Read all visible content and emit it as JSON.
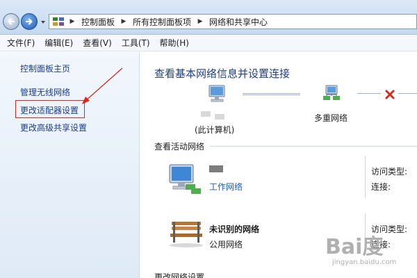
{
  "breadcrumb": {
    "items": [
      "控制面板",
      "所有控制面板项",
      "网络和共享中心"
    ]
  },
  "menu": {
    "items": [
      "文件(F)",
      "编辑(E)",
      "查看(V)",
      "工具(T)",
      "帮助(H)"
    ]
  },
  "sidebar": {
    "links": [
      "控制面板主页",
      "管理无线网络",
      "更改适配器设置",
      "更改高级共享设置"
    ],
    "highlighted": "更改适配器设置"
  },
  "main": {
    "title": "查看基本网络信息并设置连接",
    "map": {
      "this_computer": "(此计算机)",
      "multi_network": "多重网络"
    },
    "active_networks_header": "查看活动网络",
    "networks": [
      {
        "name": "",
        "type": "工作网络",
        "access_label": "访问类型:",
        "conn_label": "连接:"
      },
      {
        "name": "未识别的网络",
        "type": "公用网络",
        "access_label": "访问类型:",
        "conn_label": "连接:"
      }
    ],
    "change_settings_header": "更改网络设置"
  },
  "colors": {
    "accent": "#1e3f8a",
    "link": "#1a5fc4",
    "annotation": "#e0241b"
  },
  "watermark": {
    "text": "Bai度",
    "sub": "jingyan.baidu.com"
  }
}
